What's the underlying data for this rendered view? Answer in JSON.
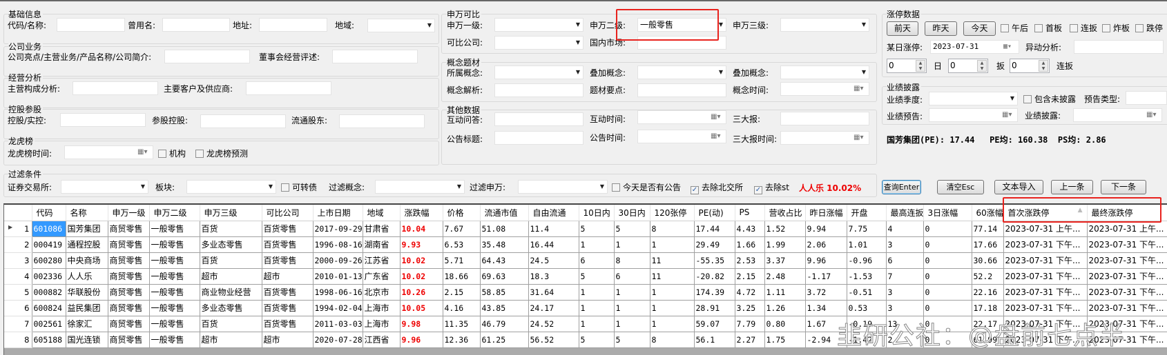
{
  "basic": {
    "title": "基础信息",
    "code_label": "代码/名称:",
    "code_value": "",
    "alias_label": "曾用名:",
    "alias_value": "",
    "addr_label": "地址:",
    "addr_value": "",
    "region_label": "地域:",
    "region_value": ""
  },
  "business": {
    "title": "公司业务",
    "highlight_label": "公司亮点/主营业务/产品名称/公司简介:",
    "highlight_value": "",
    "board_label": "董事会经营评述:",
    "board_value": ""
  },
  "operation": {
    "title": "经营分析",
    "composition_label": "主营构成分析:",
    "composition_value": "",
    "customers_label": "主要客户及供应商:",
    "customers_value": ""
  },
  "holding": {
    "title": "控股参股",
    "control_label": "控股/实控:",
    "control_value": "",
    "stake_label": "参股控股:",
    "stake_value": "",
    "float_label": "流通股东:",
    "float_value": ""
  },
  "dragon": {
    "title": "龙虎榜",
    "time_label": "龙虎榜时间:",
    "time_value": "",
    "inst_label": "机构",
    "forecast_label": "龙虎榜预测"
  },
  "sw": {
    "title": "申万可比",
    "l1_label": "申万一级:",
    "l1_value": "",
    "l2_label": "申万二级:",
    "l2_value": "一般零售",
    "l3_label": "申万三级:",
    "l3_value": "",
    "peer_label": "可比公司:",
    "peer_value": "",
    "market_label": "国内市场:",
    "market_value": ""
  },
  "concept": {
    "title": "概念题材",
    "belong_label": "所属概念:",
    "overlay1_label": "叠加概念:",
    "overlay2_label": "叠加概念:",
    "analysis_label": "概念解析:",
    "points_label": "题材要点:",
    "time_label": "概念时间:"
  },
  "other": {
    "title": "其他数据",
    "qa_label": "互动问答:",
    "qa_time_label": "互动时间:",
    "reports_label": "三大报:",
    "notice_label": "公告标题:",
    "notice_time_label": "公告时间:",
    "reports_time_label": "三大报时间:"
  },
  "limit": {
    "title": "涨停数据",
    "btn_before": "前天",
    "btn_yesterday": "昨天",
    "btn_today": "今天",
    "cb_afternoon": "午后",
    "cb_first": "首板",
    "cb_consecutive": "连扳",
    "cb_broken": "炸板",
    "cb_down": "跌停",
    "day_label": "某日涨停:",
    "day_value": "2023-07-31",
    "anomaly_label": "异动分析:",
    "spin1": "0",
    "spin1_unit": "日",
    "spin2": "0",
    "spin2_unit": "扳",
    "spin3": "0",
    "spin3_unit": "连扳"
  },
  "perf": {
    "title": "业绩披露",
    "quarter_label": "业绩季度:",
    "include_label": "包含未披露",
    "type_label": "预告类型:",
    "forecast_label": "业绩预告:",
    "disclosure_label": "业绩披露:"
  },
  "summary": {
    "text": "国芳集团(PE): 17.44   PE均: 160.38  PS均: 2.86"
  },
  "filter": {
    "title": "过滤条件",
    "exchange_label": "证券交易所:",
    "sector_label": "板块:",
    "convertible_label": "可转债",
    "concept_label": "过滤概念:",
    "sw_label": "过滤申万:",
    "notice_today_label": "今天是否有公告",
    "exclude_bj_label": "去除北交所",
    "exclude_bj_checked": true,
    "exclude_st_label": "去除st",
    "exclude_st_checked": true,
    "highlight": "人人乐 10.02%"
  },
  "actions": {
    "query": "查询Enter",
    "clear": "清空Esc",
    "import": "文本导入",
    "prev": "上一条",
    "next": "下一条"
  },
  "colors": {
    "accent_red": "#e00000",
    "highlight_box": "#e8221d",
    "selection": "#3399ff"
  },
  "table": {
    "columns": [
      "代码",
      "名称",
      "申万一级",
      "申万二级",
      "申万三级",
      "可比公司",
      "上市日期",
      "地域",
      "涨跌幅",
      "价格",
      "流通市值",
      "自由流通",
      "10日内",
      "30日内",
      "120张停",
      "PE(动)",
      "PS",
      "营收占比",
      "昨日涨幅",
      "开盘",
      "最高连扳",
      "3日涨幅",
      "60涨幅",
      "首次涨跌停",
      "最终涨跌停"
    ],
    "sort_column": "首次涨跌停",
    "rows": [
      [
        "1",
        "601086",
        "国芳集团",
        "商贸零售",
        "一般零售",
        "百货",
        "百货零售",
        "2017-09-29",
        "甘肃省",
        "10.04",
        "7.67",
        "51.08",
        "11.4",
        "5",
        "5",
        "8",
        "17.44",
        "4.43",
        "1.52",
        "9.94",
        "7.75",
        "4",
        "0",
        "77.14",
        "2023-07-31 上午...",
        "2023-07-31 上午..."
      ],
      [
        "2",
        "000419",
        "通程控股",
        "商贸零售",
        "一般零售",
        "多业态零售",
        "百货零售",
        "1996-08-16",
        "湖南省",
        "9.93",
        "6.53",
        "35.48",
        "16.44",
        "1",
        "1",
        "1",
        "29.49",
        "1.66",
        "1.99",
        "2.06",
        "1.01",
        "3",
        "0",
        "17.66",
        "2023-07-31 下午...",
        "2023-07-31 下午..."
      ],
      [
        "3",
        "600280",
        "中央商场",
        "商贸零售",
        "一般零售",
        "百货",
        "百货零售",
        "2000-09-26",
        "江苏省",
        "10.02",
        "5.71",
        "64.43",
        "24.5",
        "6",
        "8",
        "11",
        "-55.35",
        "2.53",
        "3.37",
        "9.96",
        "-0.96",
        "6",
        "0",
        "30.66",
        "2023-07-31 下午...",
        "2023-07-31 下午..."
      ],
      [
        "4",
        "002336",
        "人人乐",
        "商贸零售",
        "一般零售",
        "超市",
        "超市",
        "2010-01-13",
        "广东省",
        "10.02",
        "18.66",
        "69.63",
        "18.3",
        "5",
        "6",
        "11",
        "-20.82",
        "2.15",
        "2.48",
        "-1.17",
        "-1.53",
        "7",
        "0",
        "52.2",
        "2023-07-31 下午...",
        "2023-07-31 下午..."
      ],
      [
        "5",
        "000882",
        "华联股份",
        "商贸零售",
        "一般零售",
        "商业物业经营",
        "百货零售",
        "1998-06-16",
        "北京市",
        "10.26",
        "2.15",
        "58.85",
        "31.64",
        "1",
        "1",
        "1",
        "174.39",
        "4.72",
        "1.11",
        "3.72",
        "-0.51",
        "3",
        "0",
        "22.16",
        "2023-07-31 下午...",
        "2023-07-31 下午..."
      ],
      [
        "6",
        "600824",
        "益民集团",
        "商贸零售",
        "一般零售",
        "多业态零售",
        "百货零售",
        "1994-02-04",
        "上海市",
        "10.05",
        "4.16",
        "43.85",
        "24.17",
        "1",
        "1",
        "1",
        "28.91",
        "3.25",
        "1.26",
        "1.34",
        "0.53",
        "3",
        "0",
        "17.18",
        "2023-07-31 下午...",
        "2023-07-31 下午..."
      ],
      [
        "7",
        "002561",
        "徐家汇",
        "商贸零售",
        "一般零售",
        "百货",
        "百货零售",
        "2011-03-03",
        "上海市",
        "9.98",
        "11.35",
        "46.79",
        "24.52",
        "1",
        "1",
        "1",
        "59.07",
        "7.79",
        "0.80",
        "1.67",
        "-0.19",
        "13",
        "0",
        "22.17",
        "2023-07-31 下午...",
        "2023-07-31 下午..."
      ],
      [
        "8",
        "605188",
        "国光连锁",
        "商贸零售",
        "一般零售",
        "超市",
        "超市",
        "2020-07-28",
        "江西省",
        "9.96",
        "12.36",
        "61.25",
        "56.52",
        "5",
        "5",
        "8",
        "56.1",
        "2.27",
        "1.75",
        "-2.94",
        "-1.42",
        "2",
        "0",
        "61.99",
        "2023-07-31 下午...",
        "2023-07-31 下午..."
      ]
    ]
  },
  "watermark": "韭研公社：@盘前七点半"
}
